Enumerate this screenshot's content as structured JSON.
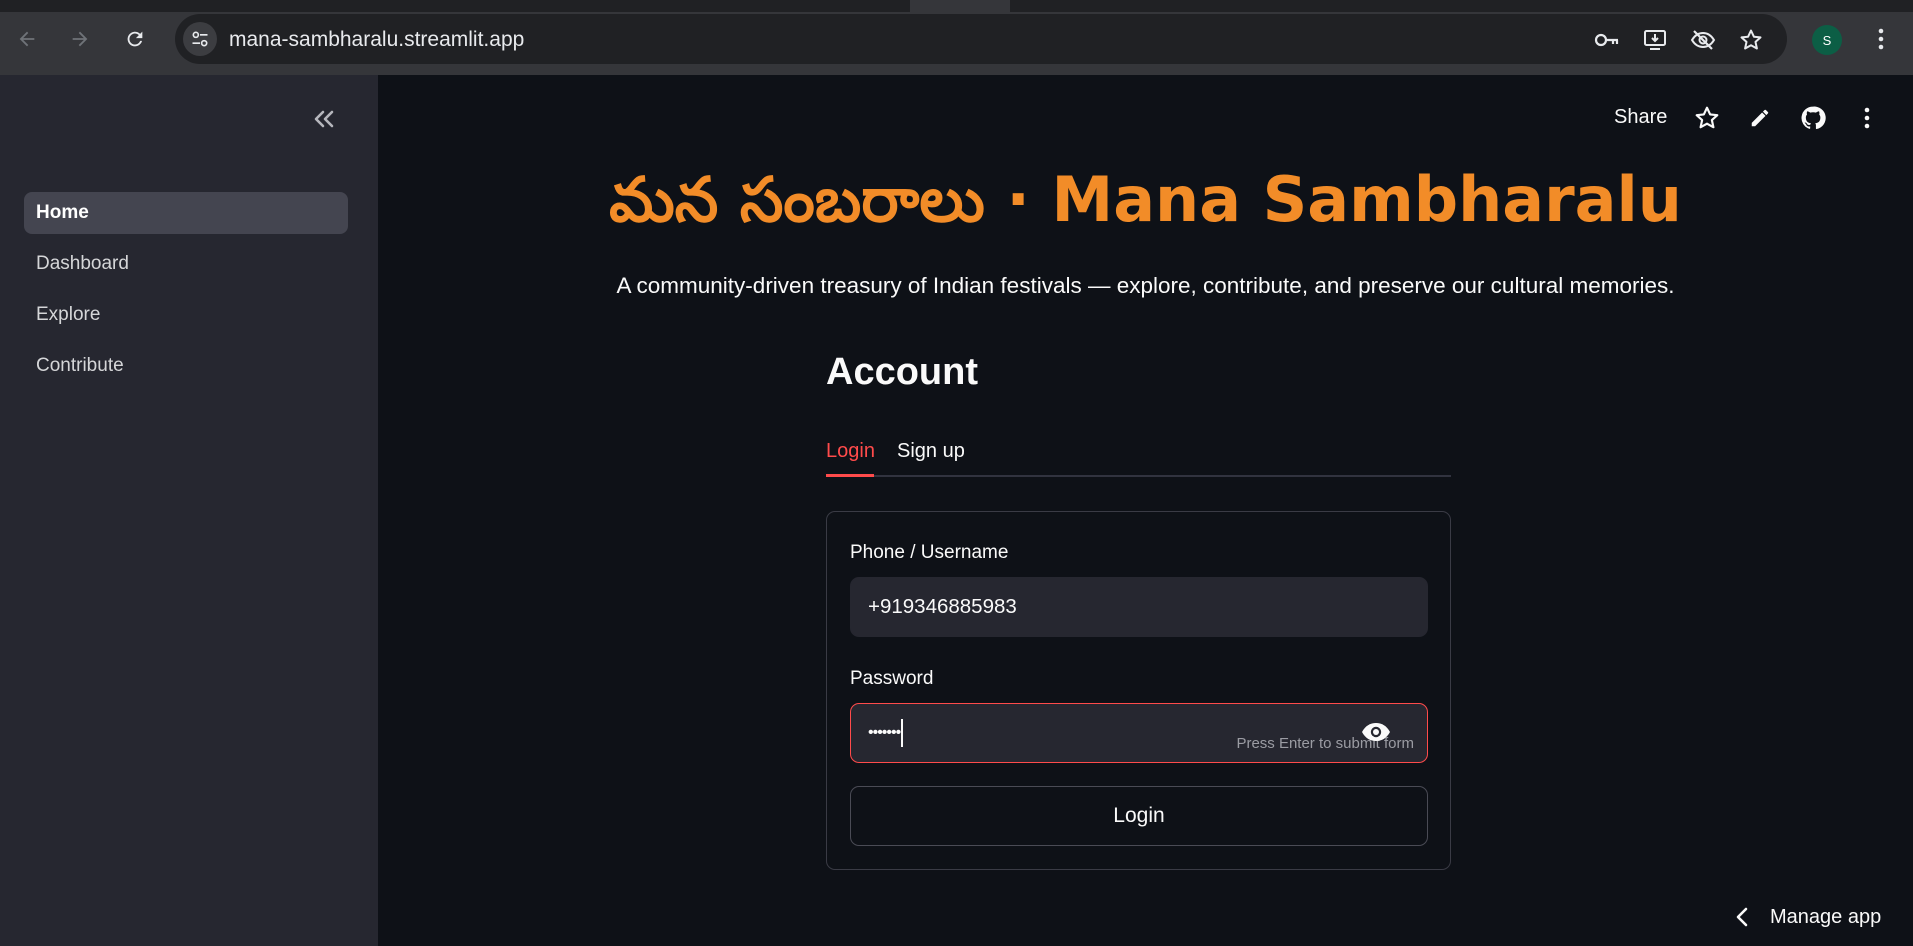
{
  "browser": {
    "url": "mana-sambharalu.streamlit.app",
    "profile_initial": "S"
  },
  "sidebar": {
    "items": [
      {
        "label": "Home",
        "active": true
      },
      {
        "label": "Dashboard",
        "active": false
      },
      {
        "label": "Explore",
        "active": false
      },
      {
        "label": "Contribute",
        "active": false
      }
    ]
  },
  "toolbar": {
    "share_label": "Share"
  },
  "header": {
    "title": "మన సంబరాలు · Mana Sambharalu",
    "subtitle": "A community-driven treasury of Indian festivals — explore, contribute, and preserve our cultural memories."
  },
  "account": {
    "heading": "Account",
    "tabs": [
      {
        "label": "Login",
        "selected": true
      },
      {
        "label": "Sign up",
        "selected": false
      }
    ],
    "form": {
      "username_label": "Phone / Username",
      "username_value": "+919346885983",
      "password_label": "Password",
      "password_value": "•••••••",
      "password_hint": "Press Enter to submit form",
      "login_button": "Login"
    }
  },
  "footer": {
    "manage_app": "Manage app"
  },
  "colors": {
    "accent": "#ff4b4b",
    "title": "#f28c28",
    "background": "#0e1117",
    "sidebar": "#262730"
  }
}
